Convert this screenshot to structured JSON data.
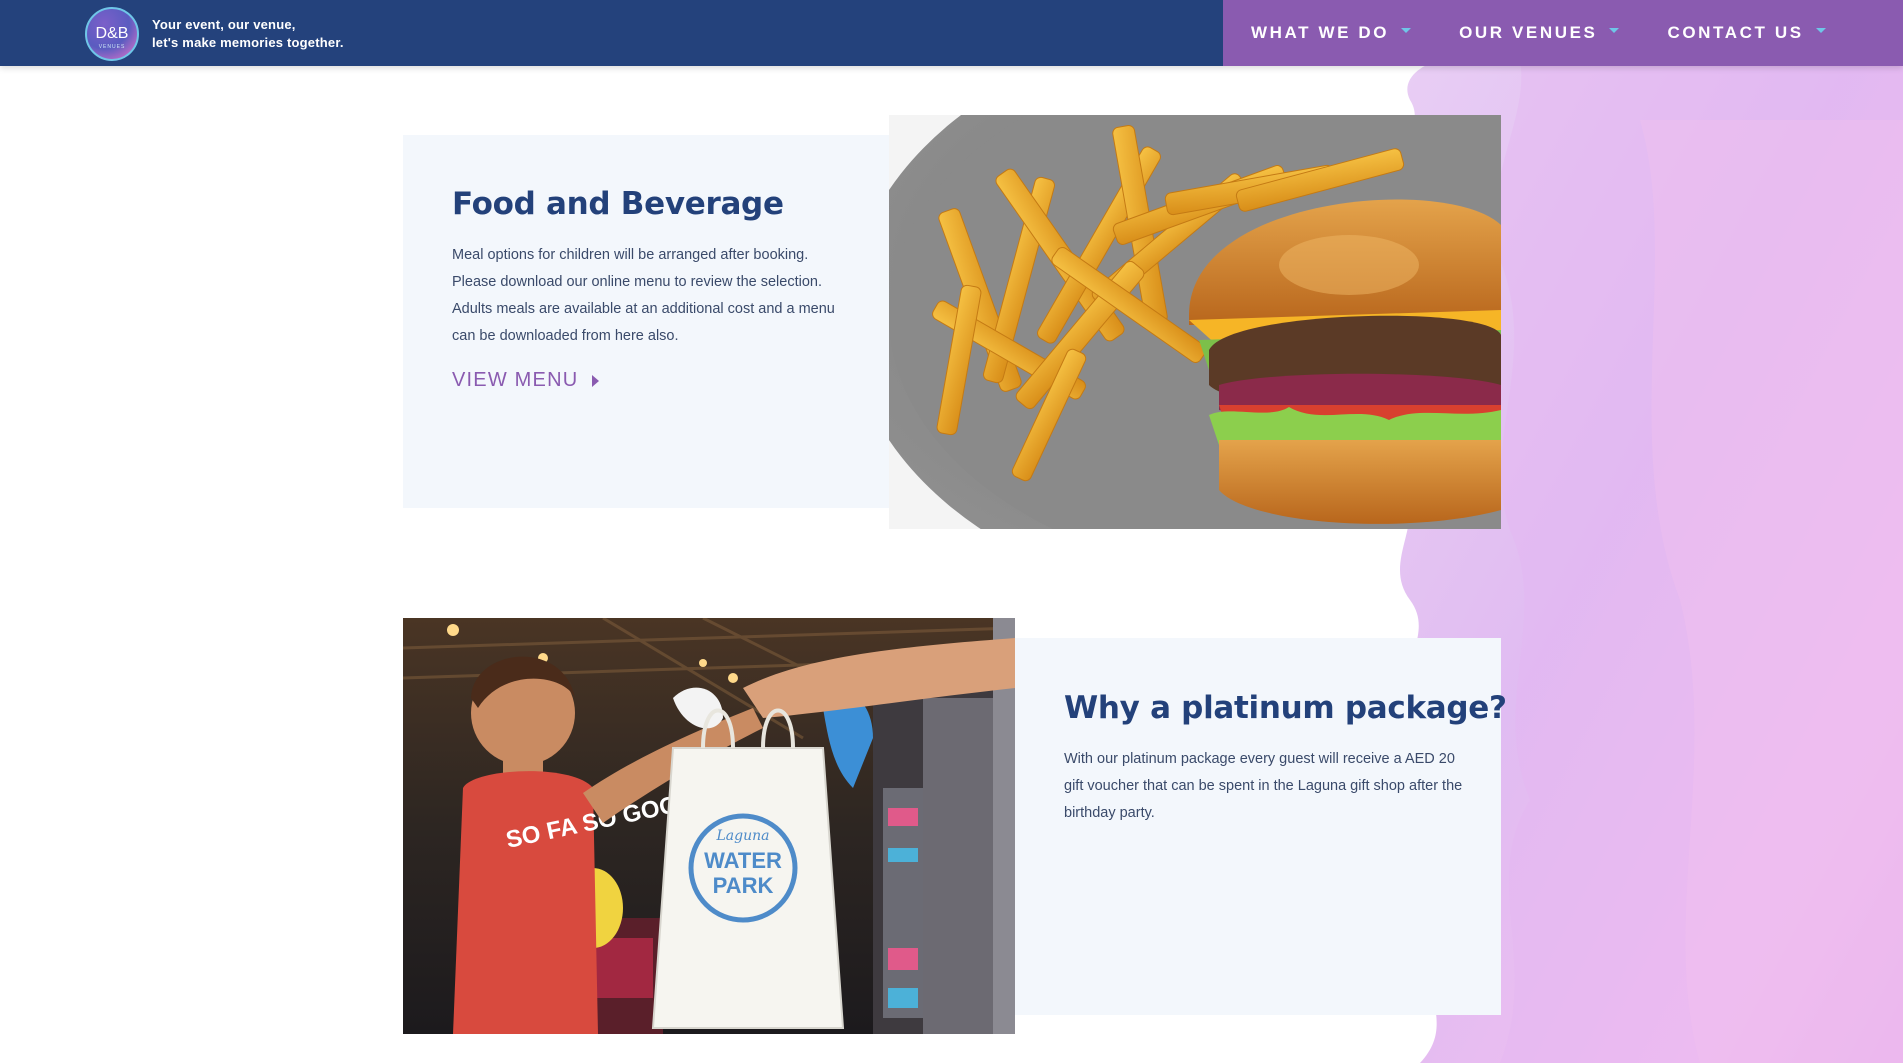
{
  "header": {
    "logo_text": "D&B",
    "logo_subtext": "VENUES",
    "tagline_line1": "Your event, our venue,",
    "tagline_line2": "let's make memories together.",
    "nav": [
      {
        "label": "WHAT WE DO"
      },
      {
        "label": "OUR VENUES"
      },
      {
        "label": "CONTACT US"
      }
    ]
  },
  "food": {
    "title": "Food and Beverage",
    "body": [
      "Meal options for children will be arranged after booking.",
      "Please download our online menu to review the selection.",
      "Adults meals are available at an additional cost and a menu",
      "can be downloaded from here also."
    ],
    "cta": "VIEW MENU",
    "image_alt": "burger-and-fries-photo"
  },
  "platinum": {
    "title": "Why a platinum package?",
    "body": [
      "With our platinum package every guest will receive a AED 20",
      "gift voucher that can be spent in the Laguna gift shop after the",
      "birthday party."
    ],
    "image_alt": "child-receiving-gift-bag-photo",
    "shirt_text": "SO FA SO GOO",
    "bag_brand_line1": "Laguna",
    "bag_brand_line2": "WATER",
    "bag_brand_line3": "PARK"
  },
  "colors": {
    "navy": "#24427c",
    "purple": "#8a5bb0",
    "accent_cyan": "#6fc6e8",
    "panel_bg": "#f3f7fc",
    "title": "#23417a"
  }
}
